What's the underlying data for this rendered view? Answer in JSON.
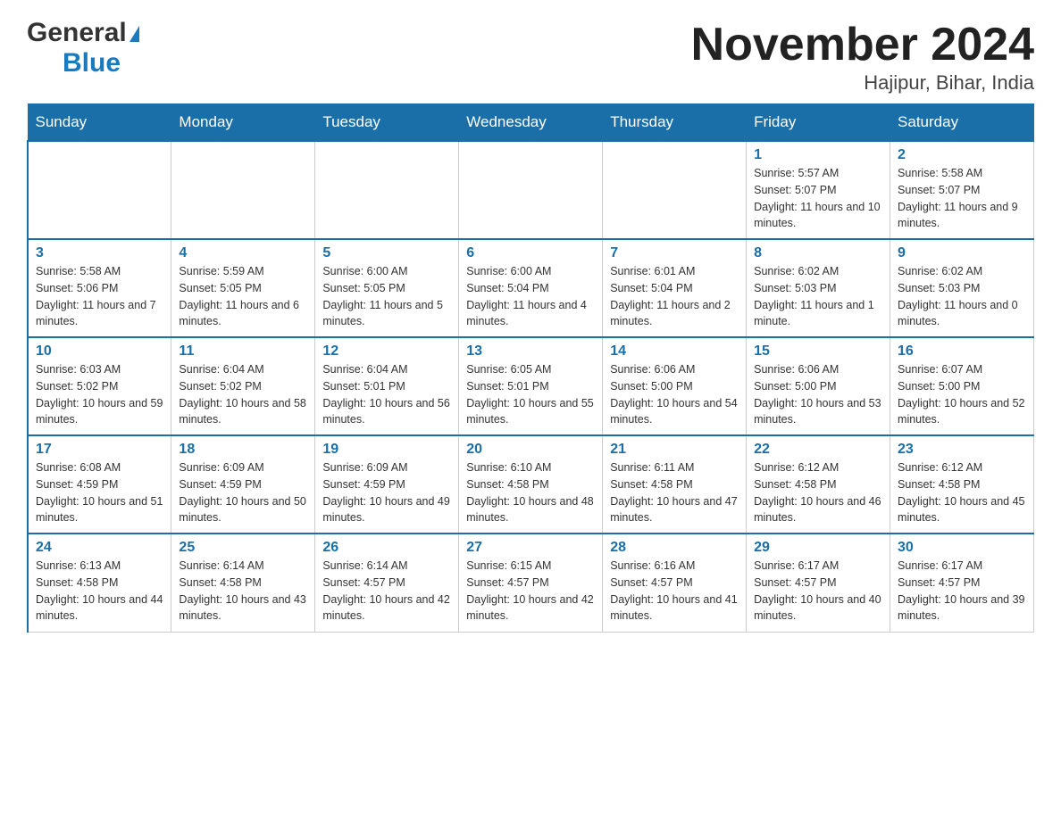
{
  "logo": {
    "general": "General",
    "blue": "Blue"
  },
  "title": "November 2024",
  "location": "Hajipur, Bihar, India",
  "days_of_week": [
    "Sunday",
    "Monday",
    "Tuesday",
    "Wednesday",
    "Thursday",
    "Friday",
    "Saturday"
  ],
  "weeks": [
    [
      {
        "day": "",
        "info": ""
      },
      {
        "day": "",
        "info": ""
      },
      {
        "day": "",
        "info": ""
      },
      {
        "day": "",
        "info": ""
      },
      {
        "day": "",
        "info": ""
      },
      {
        "day": "1",
        "info": "Sunrise: 5:57 AM\nSunset: 5:07 PM\nDaylight: 11 hours and 10 minutes."
      },
      {
        "day": "2",
        "info": "Sunrise: 5:58 AM\nSunset: 5:07 PM\nDaylight: 11 hours and 9 minutes."
      }
    ],
    [
      {
        "day": "3",
        "info": "Sunrise: 5:58 AM\nSunset: 5:06 PM\nDaylight: 11 hours and 7 minutes."
      },
      {
        "day": "4",
        "info": "Sunrise: 5:59 AM\nSunset: 5:05 PM\nDaylight: 11 hours and 6 minutes."
      },
      {
        "day": "5",
        "info": "Sunrise: 6:00 AM\nSunset: 5:05 PM\nDaylight: 11 hours and 5 minutes."
      },
      {
        "day": "6",
        "info": "Sunrise: 6:00 AM\nSunset: 5:04 PM\nDaylight: 11 hours and 4 minutes."
      },
      {
        "day": "7",
        "info": "Sunrise: 6:01 AM\nSunset: 5:04 PM\nDaylight: 11 hours and 2 minutes."
      },
      {
        "day": "8",
        "info": "Sunrise: 6:02 AM\nSunset: 5:03 PM\nDaylight: 11 hours and 1 minute."
      },
      {
        "day": "9",
        "info": "Sunrise: 6:02 AM\nSunset: 5:03 PM\nDaylight: 11 hours and 0 minutes."
      }
    ],
    [
      {
        "day": "10",
        "info": "Sunrise: 6:03 AM\nSunset: 5:02 PM\nDaylight: 10 hours and 59 minutes."
      },
      {
        "day": "11",
        "info": "Sunrise: 6:04 AM\nSunset: 5:02 PM\nDaylight: 10 hours and 58 minutes."
      },
      {
        "day": "12",
        "info": "Sunrise: 6:04 AM\nSunset: 5:01 PM\nDaylight: 10 hours and 56 minutes."
      },
      {
        "day": "13",
        "info": "Sunrise: 6:05 AM\nSunset: 5:01 PM\nDaylight: 10 hours and 55 minutes."
      },
      {
        "day": "14",
        "info": "Sunrise: 6:06 AM\nSunset: 5:00 PM\nDaylight: 10 hours and 54 minutes."
      },
      {
        "day": "15",
        "info": "Sunrise: 6:06 AM\nSunset: 5:00 PM\nDaylight: 10 hours and 53 minutes."
      },
      {
        "day": "16",
        "info": "Sunrise: 6:07 AM\nSunset: 5:00 PM\nDaylight: 10 hours and 52 minutes."
      }
    ],
    [
      {
        "day": "17",
        "info": "Sunrise: 6:08 AM\nSunset: 4:59 PM\nDaylight: 10 hours and 51 minutes."
      },
      {
        "day": "18",
        "info": "Sunrise: 6:09 AM\nSunset: 4:59 PM\nDaylight: 10 hours and 50 minutes."
      },
      {
        "day": "19",
        "info": "Sunrise: 6:09 AM\nSunset: 4:59 PM\nDaylight: 10 hours and 49 minutes."
      },
      {
        "day": "20",
        "info": "Sunrise: 6:10 AM\nSunset: 4:58 PM\nDaylight: 10 hours and 48 minutes."
      },
      {
        "day": "21",
        "info": "Sunrise: 6:11 AM\nSunset: 4:58 PM\nDaylight: 10 hours and 47 minutes."
      },
      {
        "day": "22",
        "info": "Sunrise: 6:12 AM\nSunset: 4:58 PM\nDaylight: 10 hours and 46 minutes."
      },
      {
        "day": "23",
        "info": "Sunrise: 6:12 AM\nSunset: 4:58 PM\nDaylight: 10 hours and 45 minutes."
      }
    ],
    [
      {
        "day": "24",
        "info": "Sunrise: 6:13 AM\nSunset: 4:58 PM\nDaylight: 10 hours and 44 minutes."
      },
      {
        "day": "25",
        "info": "Sunrise: 6:14 AM\nSunset: 4:58 PM\nDaylight: 10 hours and 43 minutes."
      },
      {
        "day": "26",
        "info": "Sunrise: 6:14 AM\nSunset: 4:57 PM\nDaylight: 10 hours and 42 minutes."
      },
      {
        "day": "27",
        "info": "Sunrise: 6:15 AM\nSunset: 4:57 PM\nDaylight: 10 hours and 42 minutes."
      },
      {
        "day": "28",
        "info": "Sunrise: 6:16 AM\nSunset: 4:57 PM\nDaylight: 10 hours and 41 minutes."
      },
      {
        "day": "29",
        "info": "Sunrise: 6:17 AM\nSunset: 4:57 PM\nDaylight: 10 hours and 40 minutes."
      },
      {
        "day": "30",
        "info": "Sunrise: 6:17 AM\nSunset: 4:57 PM\nDaylight: 10 hours and 39 minutes."
      }
    ]
  ]
}
